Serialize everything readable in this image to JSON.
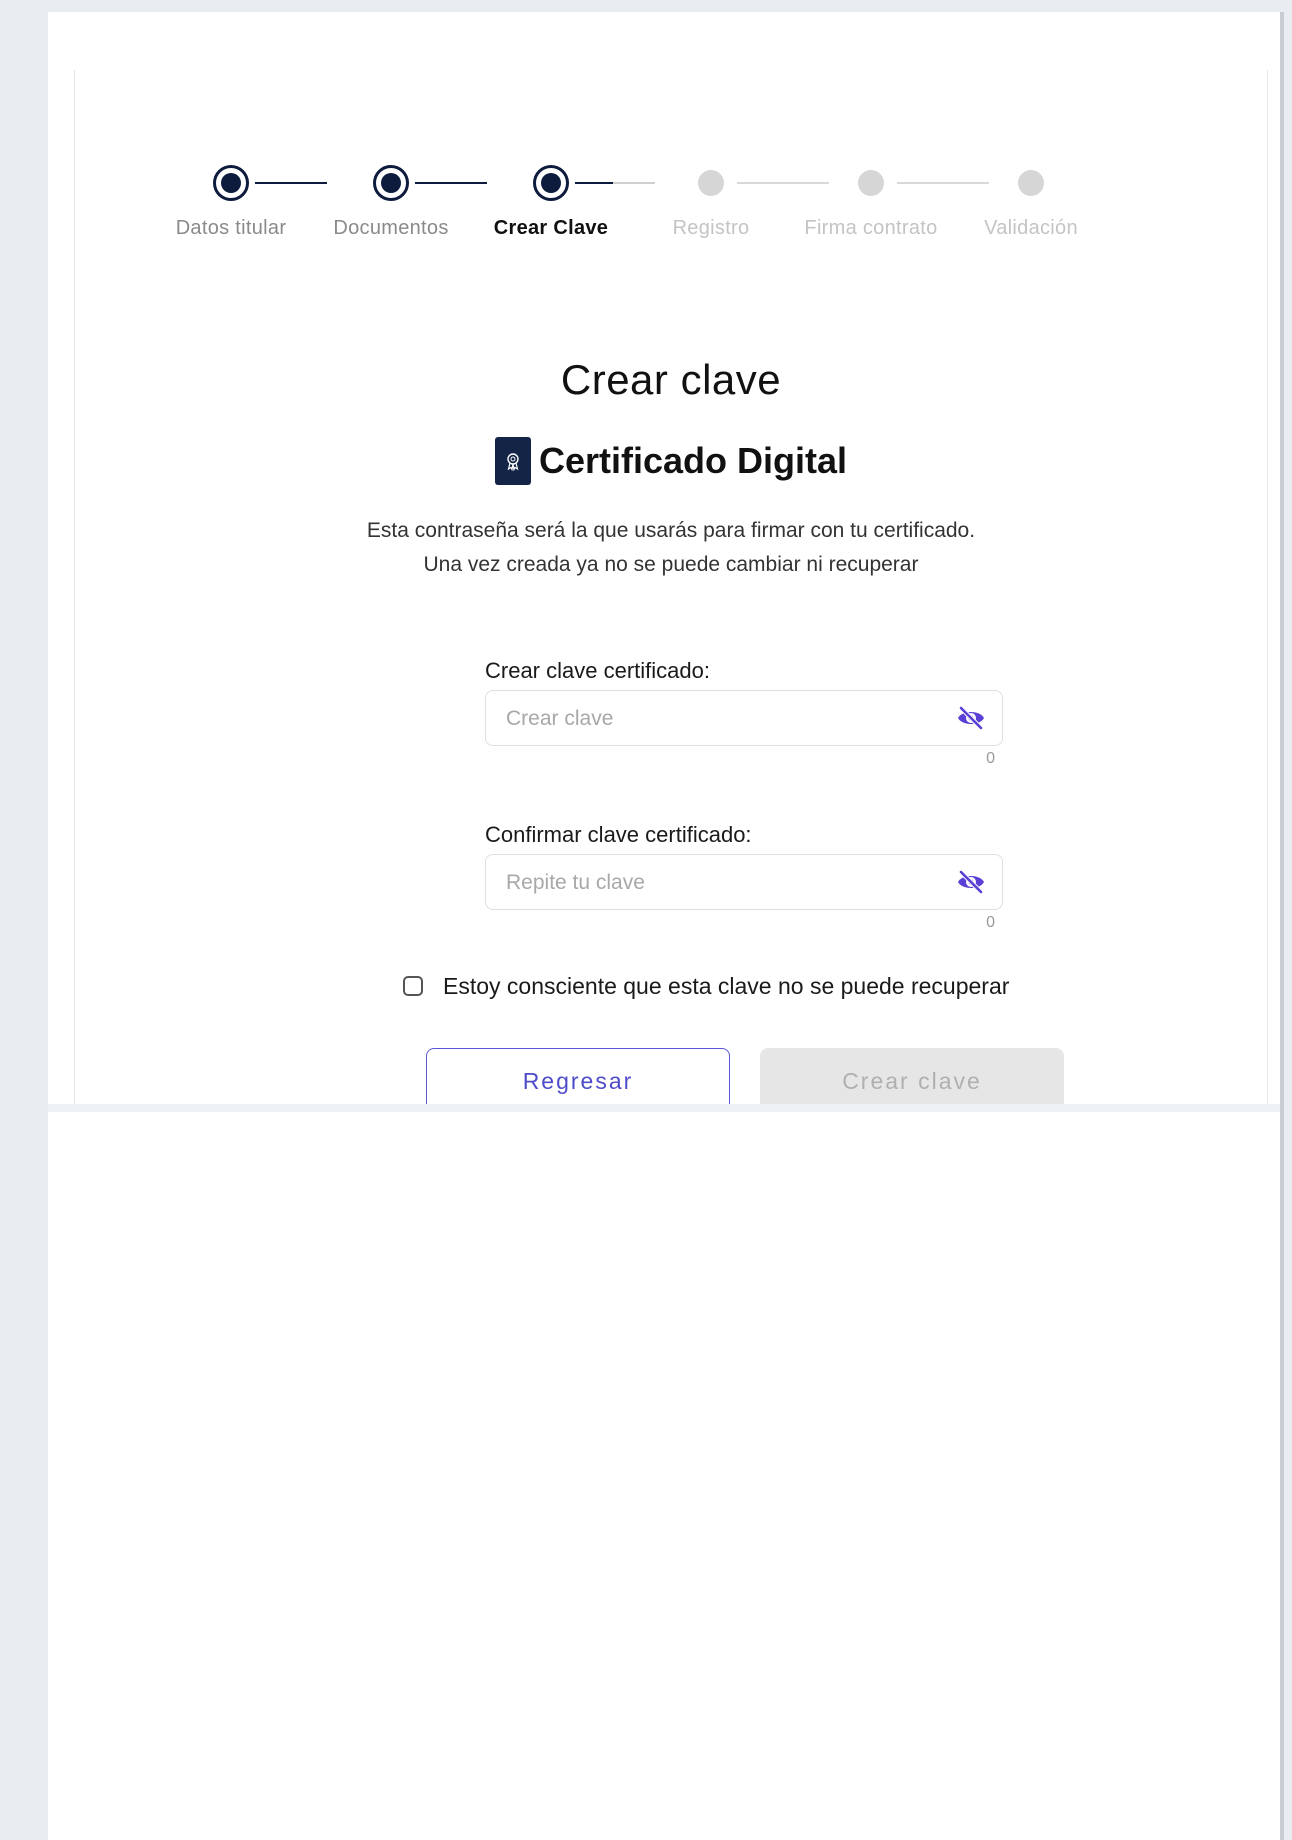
{
  "stepper": {
    "steps": [
      {
        "label": "Datos titular",
        "state": "done"
      },
      {
        "label": "Documentos",
        "state": "done"
      },
      {
        "label": "Crear Clave",
        "state": "active"
      },
      {
        "label": "Registro",
        "state": "pending"
      },
      {
        "label": "Firma contrato",
        "state": "pending"
      },
      {
        "label": "Validación",
        "state": "pending"
      }
    ]
  },
  "page": {
    "title": "Crear clave",
    "subtitle": "Certificado Digital",
    "icon": "certificate-badge-icon",
    "description_line1": "Esta contraseña será la que usarás para firmar con tu certificado.",
    "description_line2": "Una vez creada ya no se puede cambiar ni recuperar"
  },
  "form": {
    "password": {
      "label": "Crear clave certificado:",
      "value": "",
      "placeholder": "Crear clave",
      "counter": "0",
      "icon": "eye-slash-icon"
    },
    "confirm": {
      "label": "Confirmar clave certificado:",
      "value": "",
      "placeholder": "Repite tu clave",
      "counter": "0",
      "icon": "eye-slash-icon"
    },
    "acknowledge": {
      "label": "Estoy consciente que esta clave no se puede recuperar",
      "checked": false
    }
  },
  "actions": {
    "back_label": "Regresar",
    "create_label": "Crear clave",
    "create_enabled": false
  },
  "colors": {
    "stepper_done": "#0d1b3d",
    "stepper_pending": "#d6d6d6",
    "accent": "#5a57d8",
    "icon_purple": "#5b3fd6"
  }
}
